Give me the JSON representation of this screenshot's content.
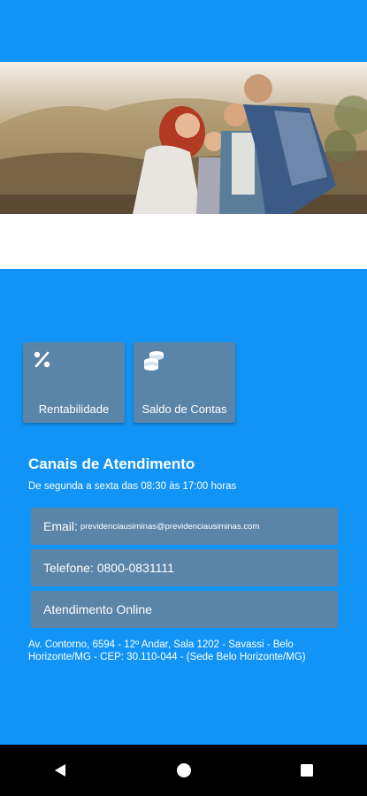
{
  "tiles": [
    {
      "label": "Rentabilidade",
      "icon": "percent-icon"
    },
    {
      "label": "Saldo de Contas",
      "icon": "coins-icon"
    }
  ],
  "channels": {
    "title": "Canais de Atendimento",
    "hours": "De segunda a sexta das 08:30 às 17:00 horas",
    "email_label": "Email:",
    "email_value": "previdenciausiminas@previdenciausiminas.com",
    "phone": "Telefone: 0800-0831111",
    "online": "Atendimento Online",
    "address": "Av. Contorno, 6594 - 12º Andar, Sala 1202 - Savassi - Belo Horizonte/MG - CEP: 30.110-044 - (Sede Belo Horizonte/MG)"
  },
  "hero": {
    "image": "family-photo"
  },
  "navbar": {
    "icons": [
      "back-icon",
      "home-icon",
      "recents-icon"
    ]
  },
  "colors": {
    "background": "#1194f6",
    "card": "#5b84a9",
    "text": "#ffffff",
    "navbar": "#000000"
  }
}
